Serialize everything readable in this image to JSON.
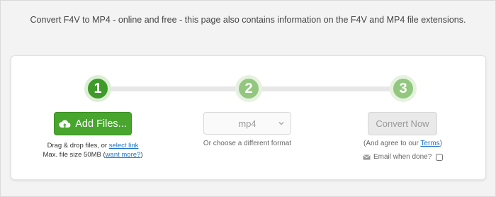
{
  "intro_text": "Convert F4V to MP4 - online and free - this page also contains information on the F4V and MP4 file extensions.",
  "steps": [
    "1",
    "2",
    "3"
  ],
  "upload": {
    "button_label": "Add Files...",
    "drag_text": "Drag & drop files, or ",
    "select_link": "select link",
    "max_size_text": "Max. file size 50MB ",
    "want_more_link": "want more?"
  },
  "format": {
    "selected": "mp4",
    "hint": "Or choose a different format"
  },
  "convert": {
    "button_label": "Convert Now",
    "terms_prefix": "(And agree to our ",
    "terms_link": "Terms",
    "terms_suffix": ")",
    "email_label": "Email when done?"
  },
  "colors": {
    "accent": "#48a62e",
    "accent_dark": "#3f9a2a",
    "step_inactive": "#93c77f",
    "link": "#1b73c9"
  },
  "icons": {
    "upload": "cloud-upload-icon",
    "dropdown": "chevron-down-icon",
    "email": "envelope-icon"
  }
}
